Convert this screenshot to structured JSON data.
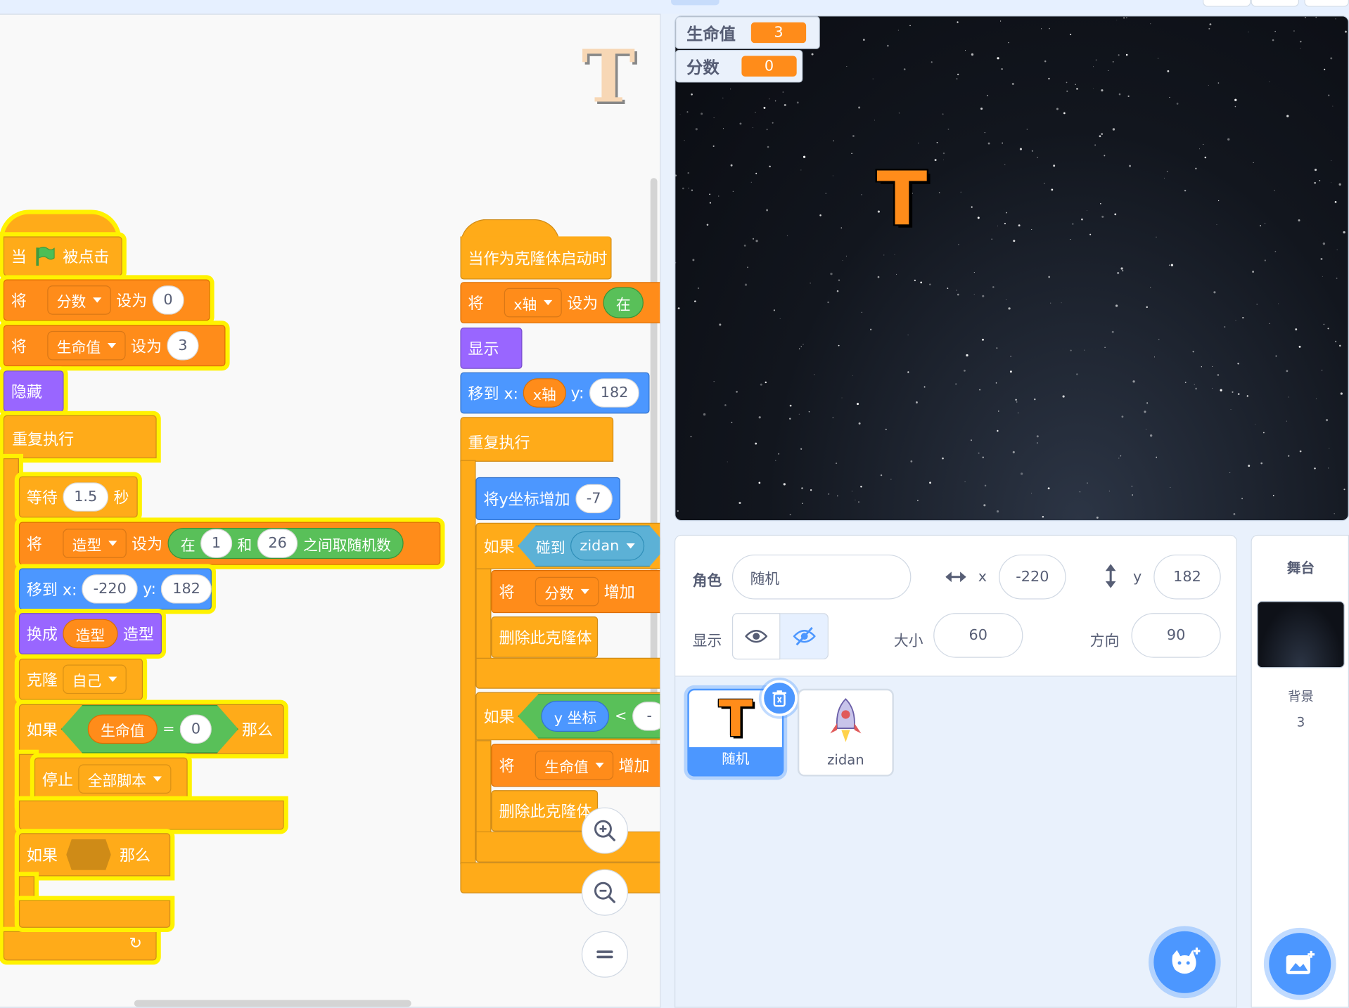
{
  "code": {
    "script1": {
      "hat_when": "当",
      "hat_clicked": "被点击",
      "set1_label": "将",
      "set1_var": "分数",
      "set1_to": "设为",
      "set1_value": "0",
      "set2_label": "将",
      "set2_var": "生命值",
      "set2_to": "设为",
      "set2_value": "3",
      "hide": "隐藏",
      "forever": "重复执行",
      "wait_label": "等待",
      "wait_value": "1.5",
      "wait_unit": "秒",
      "set3_label": "将",
      "set3_var": "造型",
      "set3_to": "设为",
      "rand_in": "在",
      "rand_from": "1",
      "rand_and": "和",
      "rand_to": "26",
      "rand_suffix": "之间取随机数",
      "goto_label": "移到 x:",
      "goto_x": "-220",
      "goto_y_label": "y:",
      "goto_y": "182",
      "switch_label": "换成",
      "switch_var": "造型",
      "switch_suffix": "造型",
      "clone_label": "克隆",
      "clone_target": "自己",
      "if1_label": "如果",
      "if1_var": "生命值",
      "if1_op": "=",
      "if1_value": "0",
      "if1_then": "那么",
      "stop_label": "停止",
      "stop_option": "全部脚本",
      "if2_label": "如果",
      "if2_then": "那么"
    },
    "script2": {
      "hat": "当作为克隆体启动时",
      "set_label": "将",
      "set_var": "x轴",
      "set_to": "设为",
      "set_in": "在",
      "show": "显示",
      "goto_label": "移到 x:",
      "goto_x": "x轴",
      "goto_y_label": "y:",
      "goto_y": "182",
      "forever": "重复执行",
      "changey_label": "将y坐标增加",
      "changey_value": "-7",
      "if1_label": "如果",
      "touch_label": "碰到",
      "touch_target": "zidan",
      "inc1_label": "将",
      "inc1_var": "分数",
      "inc1_op": "增加",
      "del1": "删除此克隆体",
      "if2_label": "如果",
      "ypos": "y 坐标",
      "lt": "<",
      "inc2_label": "将",
      "inc2_var": "生命值",
      "inc2_op": "增加",
      "del2": "删除此克隆体"
    }
  },
  "stage": {
    "monitor_life_label": "生命值",
    "monitor_life_value": "3",
    "monitor_score_label": "分数",
    "monitor_score_value": "0",
    "sprite_glyph": "T"
  },
  "sprite_info": {
    "sprite_label": "角色",
    "sprite_name": "随机",
    "x_label": "x",
    "x_value": "-220",
    "y_label": "y",
    "y_value": "182",
    "show_label": "显示",
    "size_label": "大小",
    "size_value": "60",
    "direction_label": "方向",
    "direction_value": "90"
  },
  "sprites": [
    {
      "name": "随机",
      "selected": true
    },
    {
      "name": "zidan",
      "selected": false
    }
  ],
  "stage_pane": {
    "title": "舞台",
    "backdrop_label": "背景",
    "backdrop_count": "3"
  },
  "colors": {
    "events": "#ffab19",
    "variables": "#ff8c1a",
    "looks": "#9966ff",
    "motion": "#4c97ff",
    "operators": "#59c059",
    "highlight": "#fff200"
  }
}
